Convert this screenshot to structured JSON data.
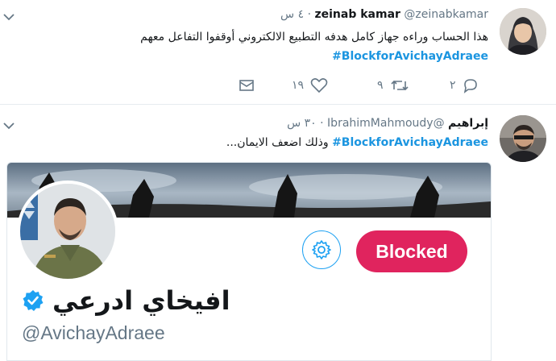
{
  "colors": {
    "accent": "#1b95e0",
    "blocked": "#e0245e",
    "muted": "#657786",
    "verified": "#1da1f2"
  },
  "tweets": [
    {
      "name": "zeinab kamar",
      "handle": "@zeinabkamar",
      "time": "٤ س",
      "dot": "·",
      "text": "هذا الحساب وراءه جهاز كامل هدفه التطبيع الالكتروني أوقفوا التفاعل معهم",
      "hashtag": "#BlockforAvichayAdraee",
      "replies": "٢",
      "retweets": "٩",
      "likes": "١٩",
      "icons": {
        "reply": "reply-icon",
        "retweet": "retweet-icon",
        "like": "heart-icon",
        "dm": "envelope-icon",
        "menu": "chevron-down-icon"
      }
    },
    {
      "name": "إبراهيم",
      "handle": "@IbrahimMahmoudy",
      "time": "٣٠ س",
      "dot": "·",
      "text": "وذلك اضعف الايمان...",
      "hashtag": "#BlockforAvichayAdraee",
      "icons": {
        "menu": "chevron-down-icon"
      }
    }
  ],
  "profile_card": {
    "display_name": "افيخاي ادرعي",
    "screen_name": "@AvichayAdraee",
    "blocked_label": "Blocked",
    "icons": {
      "settings": "gear-icon",
      "verified": "verified-badge-icon"
    }
  }
}
